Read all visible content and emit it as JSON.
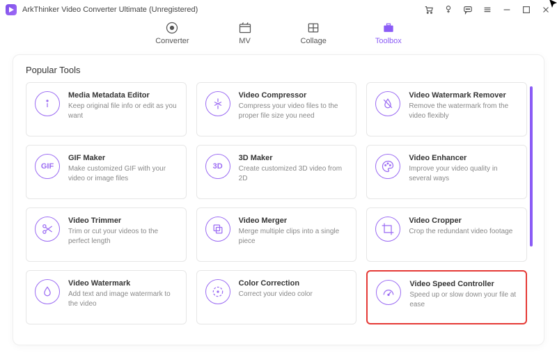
{
  "window": {
    "title": "ArkThinker Video Converter Ultimate (Unregistered)"
  },
  "tabs": {
    "converter": "Converter",
    "mv": "MV",
    "collage": "Collage",
    "toolbox": "Toolbox"
  },
  "section_title": "Popular Tools",
  "tools": {
    "metadata": {
      "title": "Media Metadata Editor",
      "desc": "Keep original file info or edit as you want"
    },
    "compressor": {
      "title": "Video Compressor",
      "desc": "Compress your video files to the proper file size you need"
    },
    "wmremove": {
      "title": "Video Watermark Remover",
      "desc": "Remove the watermark from the video flexibly"
    },
    "gif": {
      "title": "GIF Maker",
      "desc": "Make customized GIF with your video or image files",
      "glyph": "GIF"
    },
    "threed": {
      "title": "3D Maker",
      "desc": "Create customized 3D video from 2D",
      "glyph": "3D"
    },
    "enhancer": {
      "title": "Video Enhancer",
      "desc": "Improve your video quality in several ways"
    },
    "trimmer": {
      "title": "Video Trimmer",
      "desc": "Trim or cut your videos to the perfect length"
    },
    "merger": {
      "title": "Video Merger",
      "desc": "Merge multiple clips into a single piece"
    },
    "cropper": {
      "title": "Video Cropper",
      "desc": "Crop the redundant video footage"
    },
    "watermark": {
      "title": "Video Watermark",
      "desc": "Add text and image watermark to the video"
    },
    "color": {
      "title": "Color Correction",
      "desc": "Correct your video color"
    },
    "speed": {
      "title": "Video Speed Controller",
      "desc": "Speed up or slow down your file at ease"
    }
  }
}
